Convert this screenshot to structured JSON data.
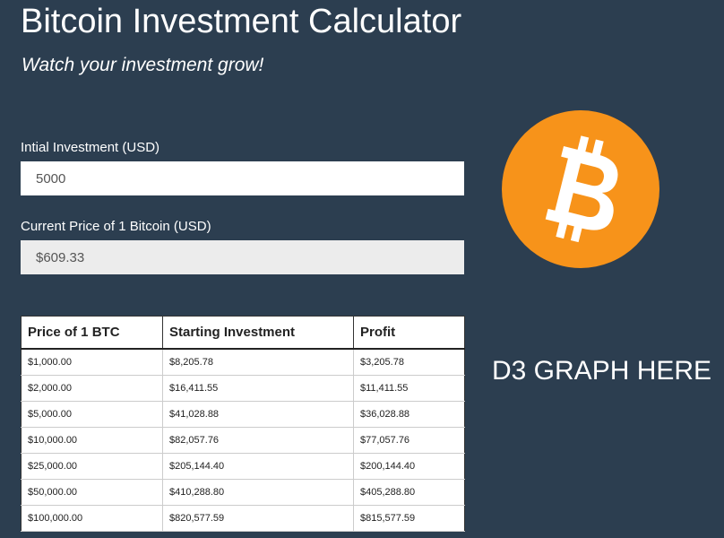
{
  "header": {
    "title": "Bitcoin Investment Calculator",
    "subtitle": "Watch your investment grow!"
  },
  "form": {
    "initial_investment": {
      "label": "Intial Investment (USD)",
      "value": "5000"
    },
    "current_price": {
      "label": "Current Price of 1 Bitcoin (USD)",
      "value": "$609.33"
    }
  },
  "table": {
    "headers": [
      "Price of 1 BTC",
      "Starting Investment",
      "Profit"
    ],
    "rows": [
      [
        "$1,000.00",
        "$8,205.78",
        "$3,205.78"
      ],
      [
        "$2,000.00",
        "$16,411.55",
        "$11,411.55"
      ],
      [
        "$5,000.00",
        "$41,028.88",
        "$36,028.88"
      ],
      [
        "$10,000.00",
        "$82,057.76",
        "$77,057.76"
      ],
      [
        "$25,000.00",
        "$205,144.40",
        "$200,144.40"
      ],
      [
        "$50,000.00",
        "$410,288.80",
        "$405,288.80"
      ],
      [
        "$100,000.00",
        "$820,577.59",
        "$815,577.59"
      ]
    ]
  },
  "graph": {
    "placeholder_text": "D3 GRAPH HERE"
  },
  "logo": {
    "icon": "bitcoin-logo-icon",
    "color": "#f7931a"
  },
  "colors": {
    "background": "#2c3e50",
    "accent": "#f7931a"
  }
}
